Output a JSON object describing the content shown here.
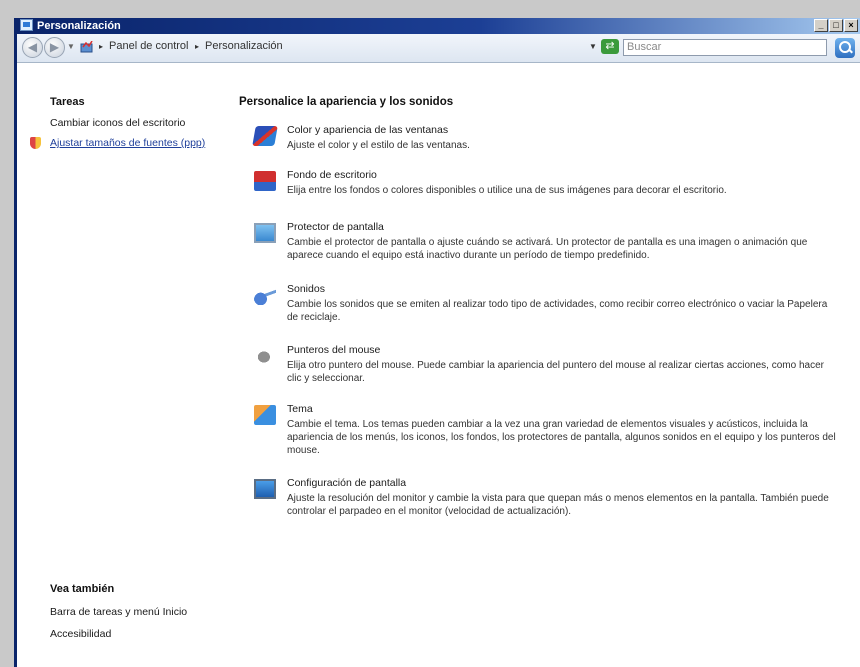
{
  "window": {
    "title": "Personalización"
  },
  "address": {
    "breadcrumbs": [
      "Panel de control",
      "Personalización"
    ],
    "search_placeholder": "Buscar"
  },
  "sidebar": {
    "tasks_heading": "Tareas",
    "tasks": [
      "Cambiar iconos del escritorio",
      "Ajustar tamaños de fuentes (ppp)"
    ],
    "see_also_heading": "Vea también",
    "see_also": [
      "Barra de tareas y menú Inicio",
      "Accesibilidad"
    ]
  },
  "main": {
    "heading": "Personalice la apariencia y los sonidos",
    "items": [
      {
        "icon": "window-color-icon",
        "title": "Color y apariencia de las ventanas",
        "desc": "Ajuste el color y el estilo de las ventanas."
      },
      {
        "icon": "desktop-background-icon",
        "title": "Fondo de escritorio",
        "desc": "Elija entre los fondos o colores disponibles o utilice una de sus imágenes para decorar el escritorio."
      },
      {
        "icon": "screensaver-icon",
        "title": "Protector de pantalla",
        "desc": "Cambie el protector de pantalla o ajuste cuándo se activará. Un protector de pantalla es una imagen o animación que aparece cuando el equipo está inactivo durante un período de tiempo predefinido."
      },
      {
        "icon": "sounds-icon",
        "title": "Sonidos",
        "desc": "Cambie los sonidos que se emiten al realizar todo tipo de actividades, como recibir correo electrónico o vaciar la Papelera de reciclaje."
      },
      {
        "icon": "mouse-pointer-icon",
        "title": "Punteros del mouse",
        "desc": "Elija otro puntero del mouse. Puede cambiar la apariencia del puntero del mouse al realizar ciertas acciones, como hacer clic y seleccionar."
      },
      {
        "icon": "theme-icon",
        "title": "Tema",
        "desc": "Cambie el tema. Los temas pueden cambiar a la vez una gran variedad de elementos visuales y acústicos, incluida la apariencia de los menús, los iconos, los fondos, los protectores de pantalla, algunos sonidos en el equipo y los punteros del mouse."
      },
      {
        "icon": "display-settings-icon",
        "title": "Configuración de pantalla",
        "desc": "Ajuste la resolución del monitor y cambie la vista para que quepan más o menos elementos en la pantalla. También puede controlar el parpadeo en el monitor (velocidad de actualización)."
      }
    ]
  }
}
